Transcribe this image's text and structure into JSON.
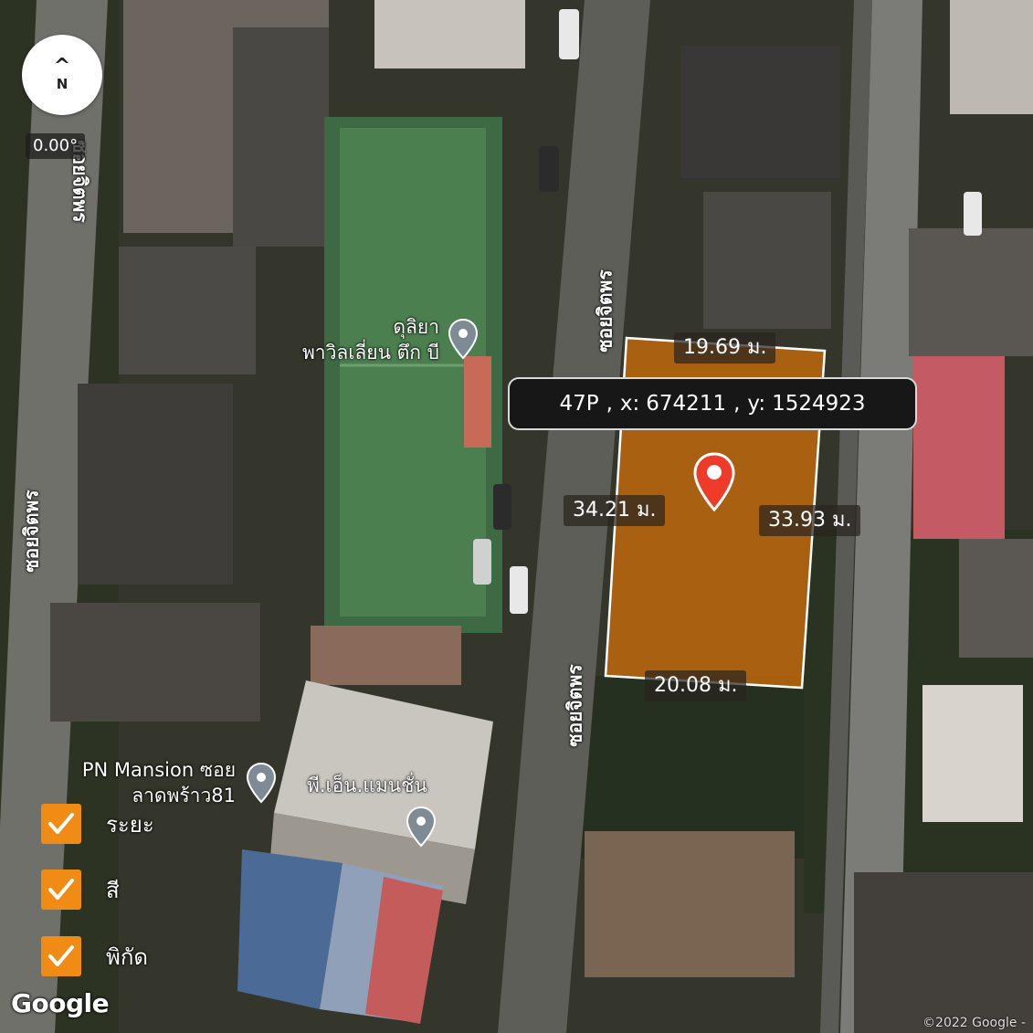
{
  "map": {
    "compass": {
      "symbol": "^",
      "north_label": "N"
    },
    "bearing": "0.00°",
    "road_labels": [
      {
        "id": "road-west-top",
        "text": "ซอยจิตพร"
      },
      {
        "id": "road-center-upper",
        "text": "ซอยจิตพร"
      },
      {
        "id": "road-west-mid",
        "text": "ซอยจิตพร"
      },
      {
        "id": "road-center-lower",
        "text": "ซอยจิตพร"
      }
    ],
    "pois": [
      {
        "id": "poi-dulia",
        "line1": "ดุลิยา",
        "line2": "พาวิลเลี่ยน ตึก บี"
      },
      {
        "id": "poi-pn-mansion-soi",
        "line1": "PN Mansion ซอย",
        "line2": "ลาดพร้าว81"
      },
      {
        "id": "poi-pn-mansion-th",
        "line1": "พี.เอ็น.แมนชั่น",
        "line2": ""
      }
    ],
    "parcel": {
      "fill_color": "#c56a0c",
      "edges": {
        "top": "19.69 ม.",
        "left": "34.21 ม.",
        "right": "33.93 ม.",
        "bottom": "20.08 ม."
      },
      "pin_color": "#ee3b2a"
    },
    "coordinate": {
      "zone": "47P",
      "x_label": "x:",
      "x": "674211",
      "y_label": "y:",
      "y": "1524923",
      "separator": ","
    },
    "toggles": [
      {
        "label": "ระยะ",
        "checked": true
      },
      {
        "label": "สี",
        "checked": true
      },
      {
        "label": "พิกัด",
        "checked": true
      }
    ],
    "attribution": {
      "logo": "Google",
      "copyright": "©2022 Google -"
    },
    "accent_color": "#f08b16"
  }
}
